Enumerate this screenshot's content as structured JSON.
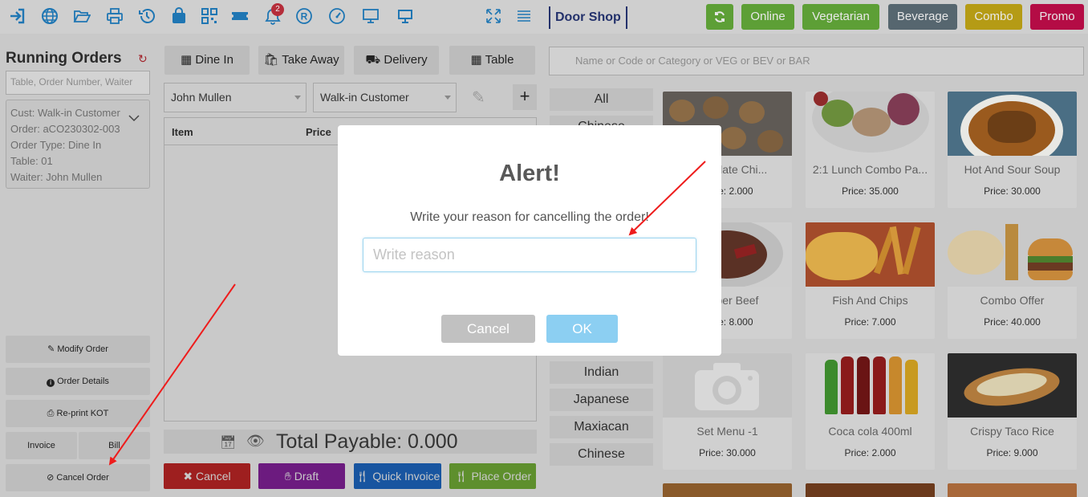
{
  "topbar": {
    "notification_count": "2",
    "brand": "Door Shop",
    "categories": [
      {
        "label": "Online",
        "color": "#5d9f36"
      },
      {
        "label": "Vegetarian",
        "color": "#5d9f36"
      },
      {
        "label": "Beverage",
        "color": "#56666f"
      },
      {
        "label": "Combo",
        "color": "#b59b15"
      },
      {
        "label": "Promo",
        "color": "#b40c45"
      }
    ]
  },
  "running_orders": {
    "title": "Running Orders",
    "search_placeholder": "Table, Order Number, Waiter",
    "order": {
      "customer": "Cust: Walk-in Customer",
      "order_no": "Order: aCO230302-003",
      "type": "Order Type: Dine In",
      "table": "Table: 01",
      "waiter": "Waiter: John Mullen"
    },
    "buttons": {
      "modify": "Modify Order",
      "details": "Order Details",
      "reprint": "Re-print KOT",
      "invoice": "Invoice",
      "bill": "Bill",
      "cancel_order": "Cancel Order"
    }
  },
  "cart": {
    "order_types": [
      "Dine In",
      "Take Away",
      "Delivery",
      "Table"
    ],
    "waiter": "John Mullen",
    "customer": "Walk-in Customer",
    "columns": [
      "Item",
      "Price"
    ],
    "total": "Total Payable: 0.000",
    "actions": {
      "cancel": "Cancel",
      "draft": "Draft",
      "quick_invoice": "Quick Invoice",
      "place_order": "Place Order"
    }
  },
  "products": {
    "search_placeholder": "Name or Code or Category or VEG or BEV or BAR",
    "categories": [
      "All",
      "Chinese",
      "Indian",
      "Japanese",
      "Maxiacan",
      "Chinese"
    ],
    "items": [
      {
        "name": "Chocolate Chi...",
        "price": "Price: 2.000"
      },
      {
        "name": "2:1 Lunch Combo Pa...",
        "price": "Price: 35.000"
      },
      {
        "name": "Hot And Sour Soup",
        "price": "Price: 30.000"
      },
      {
        "name": "Pepper Beef",
        "price": "Price: 8.000"
      },
      {
        "name": "Fish And Chips",
        "price": "Price: 7.000"
      },
      {
        "name": "Combo Offer",
        "price": "Price: 40.000"
      },
      {
        "name": "Set Menu -1",
        "price": "Price: 30.000"
      },
      {
        "name": "Coca cola 400ml",
        "price": "Price: 2.000"
      },
      {
        "name": "Crispy Taco Rice",
        "price": "Price: 9.000"
      }
    ]
  },
  "modal": {
    "title": "Alert!",
    "message": "Write your reason for cancelling the order!",
    "input_placeholder": "Write reason",
    "cancel_label": "Cancel",
    "ok_label": "OK"
  }
}
